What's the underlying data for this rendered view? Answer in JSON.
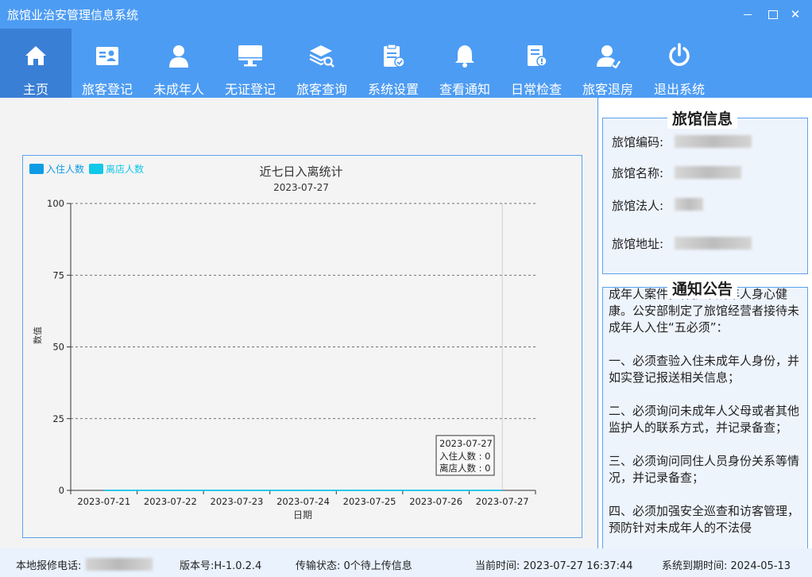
{
  "window": {
    "title": "旅馆业治安管理信息系统"
  },
  "toolbar": [
    {
      "label": "主页",
      "icon": "home-icon"
    },
    {
      "label": "旅客登记",
      "icon": "id-card-icon"
    },
    {
      "label": "未成年人",
      "icon": "person-icon"
    },
    {
      "label": "无证登记",
      "icon": "monitor-icon"
    },
    {
      "label": "旅客查询",
      "icon": "layers-search-icon"
    },
    {
      "label": "系统设置",
      "icon": "clipboard-check-icon"
    },
    {
      "label": "查看通知",
      "icon": "bell-icon"
    },
    {
      "label": "日常检查",
      "icon": "document-alert-icon"
    },
    {
      "label": "旅客退房",
      "icon": "user-checkout-icon"
    },
    {
      "label": "退出系统",
      "icon": "power-icon"
    }
  ],
  "chart_data": {
    "type": "line",
    "title": "近七日入离统计",
    "subtitle": "2023-07-27",
    "xlabel": "日期",
    "ylabel": "数值",
    "categories": [
      "2023-07-21",
      "2023-07-22",
      "2023-07-23",
      "2023-07-24",
      "2023-07-25",
      "2023-07-26",
      "2023-07-27"
    ],
    "series": [
      {
        "name": "入住人数",
        "values": [
          0,
          0,
          0,
          0,
          0,
          0,
          0
        ],
        "color": "#0e9be6"
      },
      {
        "name": "离店人数",
        "values": [
          0,
          0,
          0,
          0,
          0,
          0,
          0
        ],
        "color": "#10c8e8"
      }
    ],
    "ylim": [
      0,
      100
    ],
    "yticks": [
      0,
      25,
      50,
      75,
      100
    ],
    "grid": true,
    "legend": "top-left",
    "tooltip": {
      "date": "2023-07-27",
      "line1": "入住人数 : 0",
      "line2": "离店人数 : 0"
    }
  },
  "hotel_info": {
    "title": "旅馆信息",
    "code_label": "旅馆编码:",
    "name_label": "旅馆名称:",
    "legal_label": "旅馆法人:",
    "address_label": "旅馆地址:"
  },
  "notice": {
    "title": "通知公告",
    "paragraphs": [
      "成年人案件，保护未成年人身心健康。公安部制定了旅馆经营者接待未成年人入住“五必须”：",
      "一、必须查验入住未成年人身份，并如实登记报送相关信息；",
      "二、必须询问未成年人父母或者其他监护人的联系方式，并记录备查；",
      "三、必须询问同住人员身份关系等情况，并记录备查；",
      "四、必须加强安全巡查和访客管理，预防针对未成年人的不法侵"
    ]
  },
  "status": {
    "repair_label": "本地报修电话:",
    "version": "版本号:H-1.0.2.4",
    "transfer": "传输状态: 0个待上传信息",
    "current_time": "当前时间: 2023-07-27 16:37:44",
    "expiry": "系统到期时间: 2024-05-13"
  }
}
